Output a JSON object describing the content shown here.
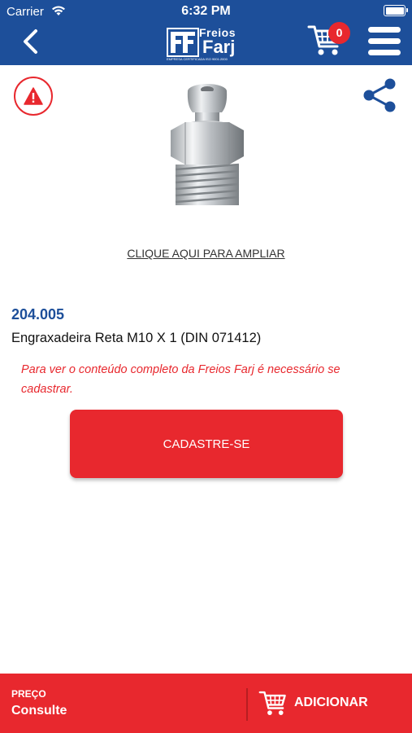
{
  "status_bar": {
    "carrier": "Carrier",
    "time": "6:32 PM"
  },
  "header": {
    "logo_line1": "Freios",
    "logo_line2": "Farj",
    "logo_tagline": "EMPRESA CERTIFICADA ISO 9001:2000",
    "cart_count": "0",
    "icons": [
      "back-chevron-icon",
      "cart-icon",
      "hamburger-menu-icon"
    ]
  },
  "product": {
    "zoom_link": "CLIQUE AQUI PARA AMPLIAR",
    "code": "204.005",
    "name": "Engraxadeira Reta M10 X 1 (DIN 071412)",
    "register_message": "Para ver o conteúdo completo da Freios Farj é necessário se cadastrar.",
    "register_button": "CADASTRE-SE",
    "image_icon": "grease-fitting-image",
    "alert_icon": "warning-icon",
    "share_icon": "share-icon"
  },
  "footer": {
    "price_label": "PREÇO",
    "price_value": "Consulte",
    "add_button": "ADICIONAR"
  },
  "colors": {
    "brand_blue": "#1d4f9a",
    "accent_red": "#e8282e"
  }
}
